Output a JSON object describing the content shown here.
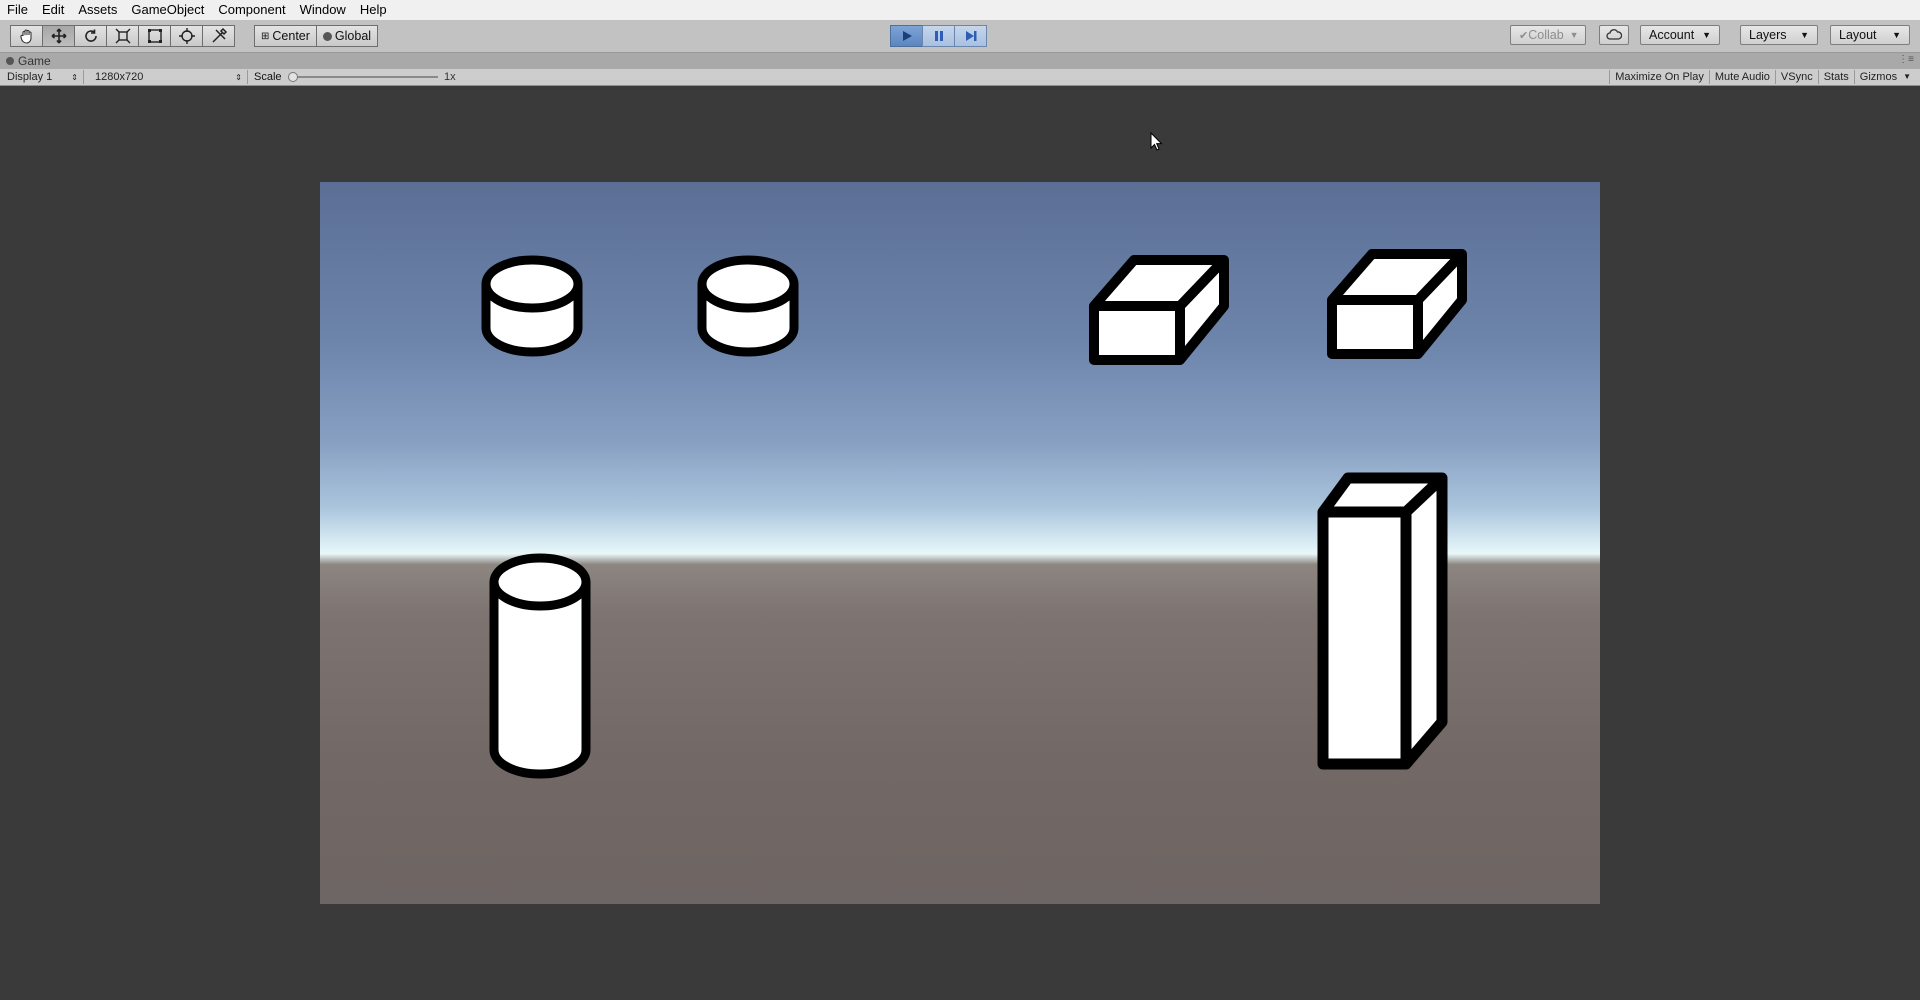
{
  "menu": [
    "File",
    "Edit",
    "Assets",
    "GameObject",
    "Component",
    "Window",
    "Help"
  ],
  "toolbar": {
    "tools": [
      "hand-tool",
      "move-tool",
      "rotate-tool",
      "scale-tool",
      "rect-tool",
      "transform-tool",
      "custom-tool"
    ],
    "active_tool": "move-tool",
    "pivot_mode": "Center",
    "pivot_rotation": "Global",
    "play_state": "playing",
    "collab": "Collab",
    "account": "Account",
    "layers": "Layers",
    "layout": "Layout"
  },
  "tab": {
    "title": "Game"
  },
  "game_bar": {
    "display": "Display 1",
    "resolution": "1280x720",
    "scale_label": "Scale",
    "scale_value": "1x",
    "buttons": [
      "Maximize On Play",
      "Mute Audio",
      "VSync",
      "Stats"
    ],
    "gizmos": "Gizmos"
  },
  "scene": {
    "objects": [
      "short-cylinder",
      "short-cylinder",
      "short-cube",
      "short-cube",
      "tall-cylinder",
      "tall-box"
    ]
  },
  "colors": {
    "play_active": "#5c86c0",
    "sky_top": "#5b6f95",
    "horizon": "#e9f7f8",
    "ground": "#6e6664"
  }
}
